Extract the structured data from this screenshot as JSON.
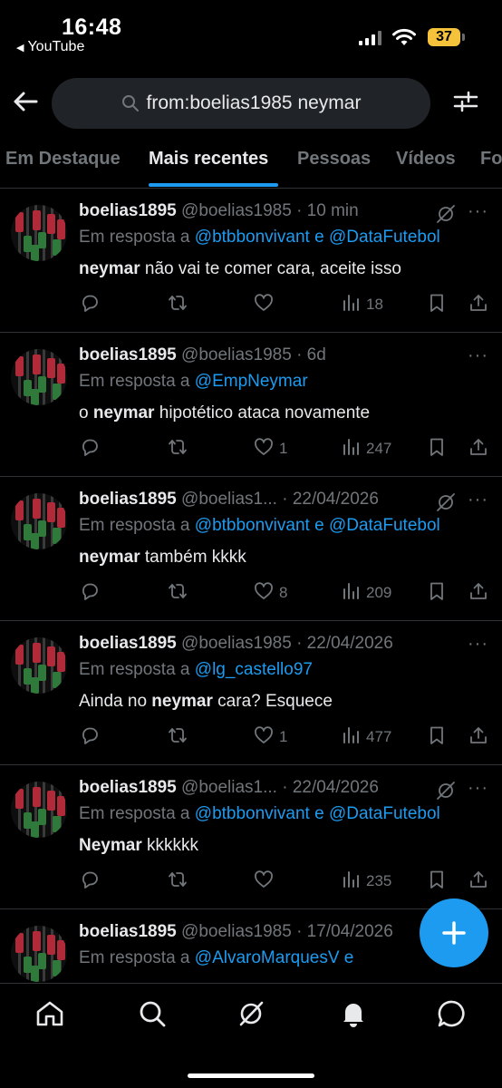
{
  "status_bar": {
    "time": "16:48",
    "back_app": "YouTube",
    "battery": "37"
  },
  "search": {
    "query": "from:boelias1985 neymar"
  },
  "tabs": [
    {
      "label": "Em Destaque",
      "active": false
    },
    {
      "label": "Mais recentes",
      "active": true
    },
    {
      "label": "Pessoas",
      "active": false
    },
    {
      "label": "Vídeos",
      "active": false
    },
    {
      "label": "Fo",
      "active": false
    }
  ],
  "tweets": [
    {
      "name": "boelias1895",
      "meta": "@boelias1985 · 10 min",
      "reply_prefix": "Em resposta a",
      "mentions": "@btbbonvivant e @DataFutebol",
      "text_before": "",
      "text_bold": "neymar",
      "text_after": " não vai te comer cara, aceite isso",
      "likes": "",
      "views": "18",
      "grok": true
    },
    {
      "name": "boelias1895",
      "meta": "@boelias1985 · 6d",
      "reply_prefix": "Em resposta a",
      "mentions": "@EmpNeymar",
      "text_before": "o ",
      "text_bold": "neymar",
      "text_after": " hipotético ataca novamente",
      "likes": "1",
      "views": "247",
      "grok": false
    },
    {
      "name": "boelias1895",
      "meta": "@boelias1... · 22/04/2026",
      "reply_prefix": "Em resposta a",
      "mentions": "@btbbonvivant e @DataFutebol",
      "text_before": "",
      "text_bold": "neymar",
      "text_after": " também kkkk",
      "likes": "8",
      "views": "209",
      "grok": true
    },
    {
      "name": "boelias1895",
      "meta": "@boelias1985 · 22/04/2026",
      "reply_prefix": "Em resposta a",
      "mentions": "@lg_castello97",
      "text_before": "Ainda no ",
      "text_bold": "neymar",
      "text_after": " cara? Esquece",
      "likes": "1",
      "views": "477",
      "grok": false
    },
    {
      "name": "boelias1895",
      "meta": "@boelias1... · 22/04/2026",
      "reply_prefix": "Em resposta a",
      "mentions": "@btbbonvivant e @DataFutebol",
      "text_before": "",
      "text_bold": "Neymar",
      "text_after": " kkkkkk",
      "likes": "",
      "views": "235",
      "grok": true
    },
    {
      "name": "boelias1895",
      "meta": "@boelias1985 · 17/04/2026",
      "reply_prefix": "Em resposta a",
      "mentions": "@AlvaroMarquesV e",
      "text_before": "",
      "text_bold": "",
      "text_after": "",
      "likes": "",
      "views": "",
      "grok": false
    }
  ],
  "colors": {
    "accent": "#1d9bf0",
    "muted": "#71767b",
    "text": "#e7e9ea",
    "divider": "#2f3336",
    "battery": "#f5c33b"
  },
  "icons": [
    "back-arrow-icon",
    "search-icon",
    "filter-icon",
    "reply-icon",
    "retweet-icon",
    "like-icon",
    "views-icon",
    "bookmark-icon",
    "share-icon",
    "grok-icon",
    "more-icon",
    "compose-icon",
    "home-icon",
    "explore-icon",
    "notifications-icon",
    "messages-icon"
  ]
}
